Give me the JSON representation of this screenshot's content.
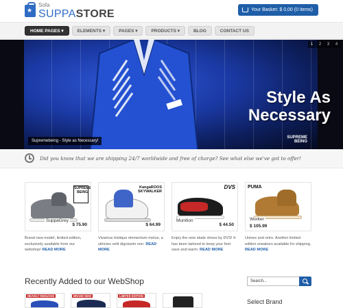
{
  "header": {
    "logo_small": "Sofa",
    "logo_part1": "SUPPA",
    "logo_part2": "STORE",
    "basket_label": "Your Basket: $ 0,00 (0 items)"
  },
  "nav": {
    "items": [
      {
        "label": "HOME PAGES ▾"
      },
      {
        "label": "ELEMENTS ▾"
      },
      {
        "label": "PAGES ▾"
      },
      {
        "label": "PRODUCTS ▾"
      },
      {
        "label": "BLOG"
      },
      {
        "label": "CONTACT US"
      }
    ]
  },
  "hero": {
    "title_line1": "Style As",
    "title_line2": "Necessary",
    "caption": "Supremebeing - Style as Necessary!",
    "brand_line1": "SUPREME",
    "brand_line2": "BEING",
    "pager": [
      "1",
      "2",
      "3",
      "4"
    ],
    "accent": "#1b3aa6"
  },
  "shipping": {
    "text": "Did you know that we are shipping 24/7 worldwide and free of charge? See what else we've got to offer!"
  },
  "products": [
    {
      "name": "SuppaGrey",
      "price": "$ 75.90",
      "brand": "SUPREME BEING",
      "desc": "Brand new model, limited edition, exclusively available from our webshop!",
      "read_more": "READ MORE"
    },
    {
      "name": "",
      "price": "$ 64.99",
      "brand": "KangaROOS SKYWALKER",
      "desc": "Vivamus tristique elementum metus, a ultricies velit dignissim non.",
      "read_more": "READ MORE"
    },
    {
      "name": "Munition",
      "price": "$ 44.50",
      "brand": "DVS",
      "desc": "Enjoy the new skate shoes by DVS! It has been tailored to keep your feet save and warm.",
      "read_more": "READ MORE"
    },
    {
      "name": "Worker",
      "price": "$ 105.99",
      "brand": "PUMA",
      "desc": "Unisex and retro. Another limited edition sneakers available for shipping.",
      "read_more": "READ MORE"
    }
  ],
  "recent": {
    "title": "Recently Added to our WebShop",
    "badges": [
      "HEAVILY REDUCED",
      "BRAND NEW",
      "LIMITED EDITION",
      ""
    ]
  },
  "sidebar": {
    "search_value": "Search...",
    "select_brand": "Select Brand"
  }
}
